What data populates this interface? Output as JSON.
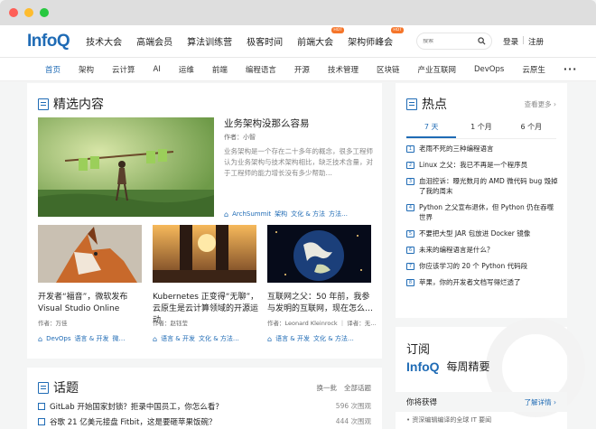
{
  "nav": {
    "logo": "InfoQ",
    "items": [
      {
        "label": "技术大会",
        "hot": false
      },
      {
        "label": "高端会员",
        "hot": false
      },
      {
        "label": "算法训练营",
        "hot": false
      },
      {
        "label": "极客时间",
        "hot": false
      },
      {
        "label": "前端大会",
        "hot": true
      },
      {
        "label": "架构师峰会",
        "hot": true
      }
    ],
    "hot_badge": "HOT",
    "search_placeholder": "搜索",
    "login": "登录",
    "separator": "|",
    "register": "注册"
  },
  "categories": [
    "首页",
    "架构",
    "云计算",
    "AI",
    "运维",
    "前端",
    "编程语言",
    "开源",
    "技术管理",
    "区块链",
    "产业互联网",
    "DevOps",
    "云原生"
  ],
  "more_label": "···",
  "featured": {
    "section_title": "精选内容",
    "main": {
      "title": "业务架构没那么容易",
      "author": "作者：小智",
      "desc": "业务架构是一个存在二十多年的概念，很多工程师认为业务架构与技术架构相比，缺乏技术含量，对于工程师的能力增长没有多少帮助…",
      "tags": [
        "ArchSummit",
        "架构",
        "文化 & 方法",
        "方法…"
      ]
    },
    "cards": [
      {
        "title": "开发者“福音”，微软发布Visual Studio Online",
        "author": "作者：万佳",
        "tags": [
          "DevOps",
          "语言 & 开发",
          "微…"
        ]
      },
      {
        "title": "Kubernetes 正变得“无聊”，云原生是云计算领域的开源运动",
        "author": "作者：赵钰莹",
        "tags": [
          "语言 & 开发",
          "文化 & 方法…"
        ]
      },
      {
        "title": "互联网之父：50 年前，我参与发明的互联网，现在怎么…",
        "author": "作者：Leonard Kleinrock ｜ 译者：无…",
        "tags": [
          "语言 & 开发",
          "文化 & 方法…"
        ]
      }
    ]
  },
  "hot": {
    "title": "热点",
    "more": "查看更多",
    "tabs": [
      "7 天",
      "1 个月",
      "6 个月"
    ],
    "active_tab": 0,
    "items": [
      "老雨不死的三种编程语言",
      "Linux 之父：我已不再是一个程序员",
      "血泪控诉：曝光数月的 AMD 微代码 bug 毁掉了我的周末",
      "Python 之父宣布退休，但 Python 仍在吞噬世界",
      "不要把大型 JAR 包放进 Docker 镜像",
      "未来的编程语言是什么？",
      "你应该学习的 20 个 Python 代码段",
      "苹果，你的开发者文档写得烂透了"
    ]
  },
  "topics": {
    "title": "话题",
    "refresh": "换一批",
    "all": "全部话题",
    "rows": [
      {
        "text": "GitLab 开始国家封锁？拒录中国员工，你怎么看？",
        "views": "596 次围观"
      },
      {
        "text": "谷歌 21 亿美元接盘 Fitbit，这是要砸苹果饭碗？",
        "views": "444 次围观"
      }
    ]
  },
  "subscribe": {
    "title": "订阅",
    "brand": "InfoQ",
    "weekly": "每周精要",
    "benefits": "你将获得",
    "learn_more": "了解详情",
    "first_item": "• 资深编辑编译的全球 IT 要闻"
  },
  "colors": {
    "accent": "#1f6bb5",
    "hot_badge": "#f5752a"
  }
}
